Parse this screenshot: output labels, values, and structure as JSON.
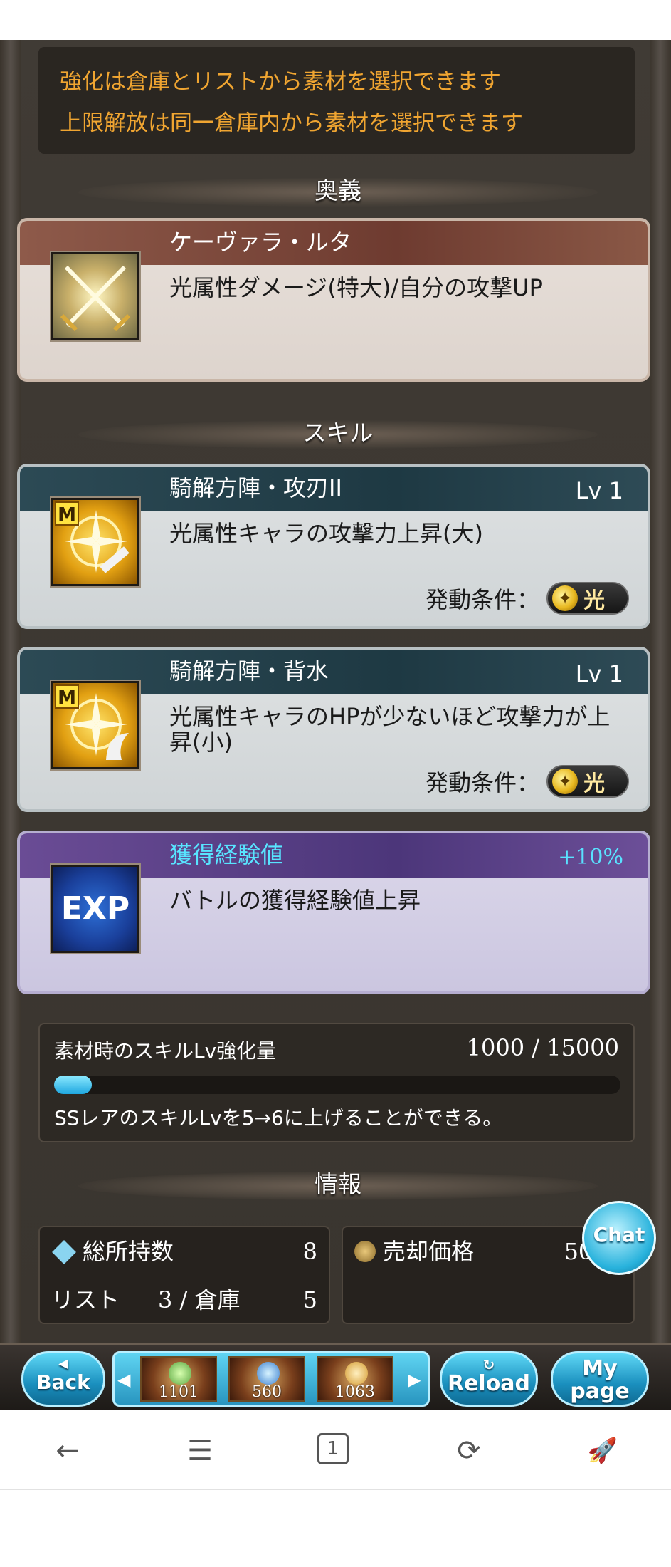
{
  "notice": {
    "line1": "強化は倉庫とリストから素材を選択できます",
    "line2": "上限解放は同一倉庫内から素材を選択できます"
  },
  "sections": {
    "ougi": "奥義",
    "skill": "スキル",
    "info": "情報"
  },
  "ougi": {
    "title": "ケーヴァラ・ルタ",
    "desc": "光属性ダメージ(特大)/自分の攻撃UP",
    "icon": "crossed-swords-icon"
  },
  "skills": [
    {
      "title": "騎解方陣・攻刃II",
      "lv": "Lv 1",
      "desc": "光属性キャラの攻撃力上昇(大)",
      "cond_label": "発動条件：",
      "cond_value": "光",
      "icon_tag": "M",
      "icon": "compass-sword-icon"
    },
    {
      "title": "騎解方陣・背水",
      "lv": "Lv 1",
      "desc": "光属性キャラのHPが少ないほど攻撃力が上昇(小)",
      "cond_label": "発動条件：",
      "cond_value": "光",
      "icon_tag": "M",
      "icon": "compass-claw-icon"
    }
  ],
  "exp_card": {
    "title": "獲得経験値",
    "bonus": "+10%",
    "desc": "バトルの獲得経験値上昇",
    "icon_text": "EXP"
  },
  "skill_lv_panel": {
    "label": "素材時のスキルLv強化量",
    "value": "1000 / 15000",
    "progress": 0.0667,
    "note": "SSレアのスキルLvを5→6に上げることができる。"
  },
  "info": {
    "total_label": "総所持数",
    "total_value": "8",
    "list_label": "リスト",
    "list_value": "3 /",
    "warehouse_label": "倉庫",
    "warehouse_value": "5",
    "sell_label": "売却価格",
    "sell_value": "5000"
  },
  "chat_button": "Chat",
  "nav": {
    "back": "Back",
    "reload": "Reload",
    "mypage_line1": "My",
    "mypage_line2": "page",
    "items": [
      "1101",
      "560",
      "1063"
    ]
  },
  "browser_nav": {
    "back_icon": "←",
    "menu_icon": "☰",
    "tabs_count": "1",
    "refresh_icon": "⟳",
    "rocket_icon": "🚀"
  },
  "colors": {
    "notice_text": "#f0a531",
    "exp_title": "#58e4ff",
    "progress_fill": "#1fa7e0"
  }
}
